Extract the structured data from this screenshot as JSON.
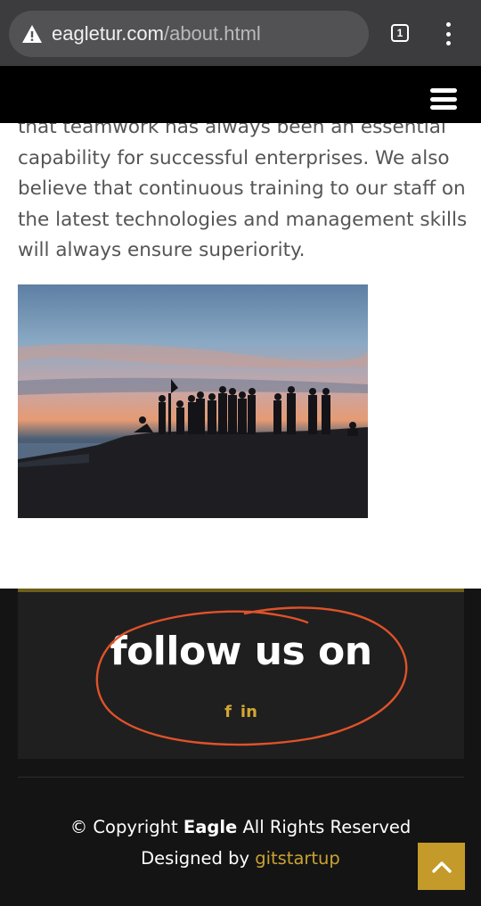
{
  "browser": {
    "url_domain": "eagletur.com",
    "url_path": "/about.html",
    "tab_count": "1",
    "warning_icon": "warning-triangle-icon",
    "menu_icon": "kebab-menu-icon"
  },
  "nav": {
    "menu_icon": "hamburger-menu-icon"
  },
  "about": {
    "lines": [
      "that teamwork has always been an essential",
      "capability for successful enterprises. We also",
      "believe that continuous training to our staff on",
      "the latest technologies and management skills",
      "will always ensure superiority."
    ]
  },
  "footer": {
    "follow_title": "follow us on",
    "social": [
      "f",
      "in"
    ],
    "copyright_prefix": "© Copyright ",
    "copyright_brand": "Eagle",
    "copyright_suffix": " All Rights Reserved",
    "designed_prefix": "Designed by ",
    "designed_link": "gitstartup"
  },
  "colors": {
    "accent": "#c49a2a",
    "footer_bg": "#141414",
    "annotation": "#e0522a"
  }
}
